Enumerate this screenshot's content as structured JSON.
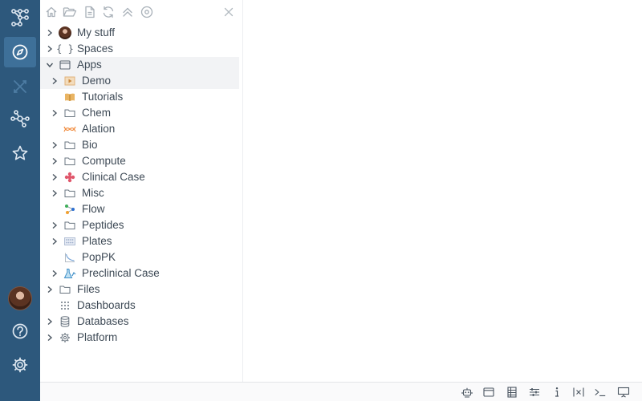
{
  "rail": {
    "items": [
      {
        "name": "logo-icon"
      },
      {
        "name": "browse-icon",
        "active": true
      },
      {
        "name": "tools-icon"
      },
      {
        "name": "network-icon"
      },
      {
        "name": "favorites-star-icon"
      }
    ],
    "bottom": [
      "user-avatar",
      "help-icon",
      "settings-gear-icon"
    ]
  },
  "toolbar": {
    "icons": [
      "home-icon",
      "open-folder-icon",
      "file-icon",
      "refresh-icon",
      "collapse-all-icon",
      "sync-icon",
      "close-icon"
    ]
  },
  "tree": {
    "items": [
      {
        "label": "My stuff",
        "icon": "user-avatar-icon",
        "expandable": true,
        "expanded": false,
        "level": 0
      },
      {
        "label": "Spaces",
        "icon": "braces-icon",
        "expandable": true,
        "expanded": false,
        "level": 0
      },
      {
        "label": "Apps",
        "icon": "window-icon",
        "expandable": true,
        "expanded": true,
        "level": 0,
        "selected": true
      },
      {
        "label": "Demo",
        "icon": "demo-icon",
        "expandable": true,
        "expanded": false,
        "level": 1,
        "selected": true
      },
      {
        "label": "Tutorials",
        "icon": "book-icon",
        "expandable": false,
        "level": 1
      },
      {
        "label": "Chem",
        "icon": "folder-icon",
        "expandable": true,
        "expanded": false,
        "level": 1
      },
      {
        "label": "Alation",
        "icon": "alation-icon",
        "expandable": false,
        "level": 1
      },
      {
        "label": "Bio",
        "icon": "folder-icon",
        "expandable": true,
        "expanded": false,
        "level": 1
      },
      {
        "label": "Compute",
        "icon": "folder-icon",
        "expandable": true,
        "expanded": false,
        "level": 1
      },
      {
        "label": "Clinical Case",
        "icon": "clinical-icon",
        "expandable": true,
        "expanded": false,
        "level": 1
      },
      {
        "label": "Misc",
        "icon": "folder-icon",
        "expandable": true,
        "expanded": false,
        "level": 1
      },
      {
        "label": "Flow",
        "icon": "flow-icon",
        "expandable": false,
        "level": 1
      },
      {
        "label": "Peptides",
        "icon": "folder-icon",
        "expandable": true,
        "expanded": false,
        "level": 1
      },
      {
        "label": "Plates",
        "icon": "plates-icon",
        "expandable": true,
        "expanded": false,
        "level": 1
      },
      {
        "label": "PopPK",
        "icon": "poppk-icon",
        "expandable": false,
        "level": 1
      },
      {
        "label": "Preclinical Case",
        "icon": "flask-icon",
        "expandable": true,
        "expanded": false,
        "level": 1
      },
      {
        "label": "Files",
        "icon": "folder-icon",
        "expandable": true,
        "expanded": false,
        "level": 0
      },
      {
        "label": "Dashboards",
        "icon": "grid-dots-icon",
        "expandable": false,
        "level": 0
      },
      {
        "label": "Databases",
        "icon": "database-icon",
        "expandable": true,
        "expanded": false,
        "level": 0
      },
      {
        "label": "Platform",
        "icon": "gear-icon",
        "expandable": true,
        "expanded": false,
        "level": 0
      }
    ]
  },
  "statusbar": {
    "icons": [
      "robot-icon",
      "window-icon",
      "table-view-icon",
      "filters-icon",
      "info-icon",
      "variables-icon",
      "console-icon",
      "presentation-icon"
    ]
  },
  "colors": {
    "rail": "#2d587c",
    "rail_active": "#3e7099",
    "selected_row": "#f2f3f5",
    "text": "#3e4a56"
  }
}
